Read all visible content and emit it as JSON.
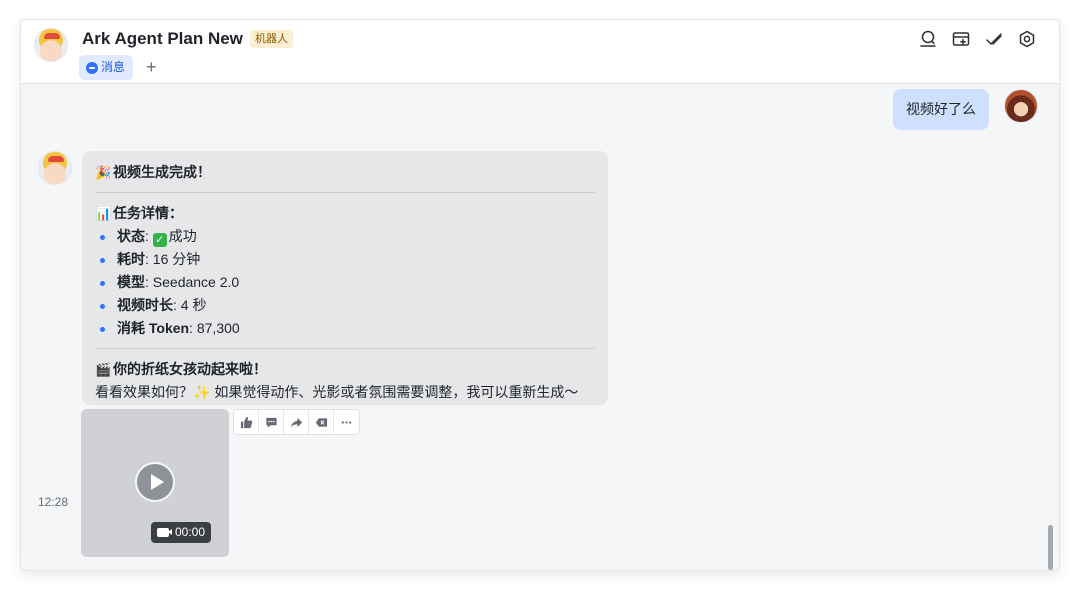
{
  "header": {
    "title": "Ark Agent Plan New",
    "bot_tag": "机器人",
    "tabs": [
      {
        "label": "消息",
        "icon": "chat-bubble-icon"
      }
    ],
    "add_tab": "+",
    "icons": [
      "search-chat-icon",
      "add-tab-icon",
      "check-icon",
      "settings-gear-icon"
    ]
  },
  "messages": {
    "user_message": "视频好了么",
    "bot_message": {
      "title_emoji": "🎉",
      "title": "视频生成完成！",
      "details_emoji": "📊",
      "details_heading": "任务详情：",
      "items": [
        {
          "label": "状态",
          "sep": ": ",
          "value": "成功",
          "check": "✓"
        },
        {
          "label": "耗时",
          "sep": ": ",
          "value": "16 分钟"
        },
        {
          "label": "模型",
          "sep": ": ",
          "value": "Seedance 2.0"
        },
        {
          "label": "视频时长",
          "sep": ": ",
          "value": "4 秒"
        },
        {
          "label": "消耗 Token",
          "sep": ": ",
          "value": "87,300"
        }
      ],
      "footer_emoji": "🎬",
      "footer_heading": "你的折纸女孩动起来啦！",
      "footer_text_1": "看看效果如何？",
      "footer_sparkle": "✨",
      "footer_text_2": " 如果觉得动作、光影或者氛围需要调整，我可以重新生成～"
    },
    "timestamp": "12:28",
    "video": {
      "duration": "00:00"
    },
    "action_icons": [
      "thumbs-up-icon",
      "comment-icon",
      "forward-icon",
      "delete-tag-icon",
      "more-icon"
    ]
  },
  "colors": {
    "accent": "#3370ff",
    "user_bubble": "#cfe0ff",
    "bot_bubble": "#e6e7e9",
    "tag_bg": "#fcefd1"
  }
}
